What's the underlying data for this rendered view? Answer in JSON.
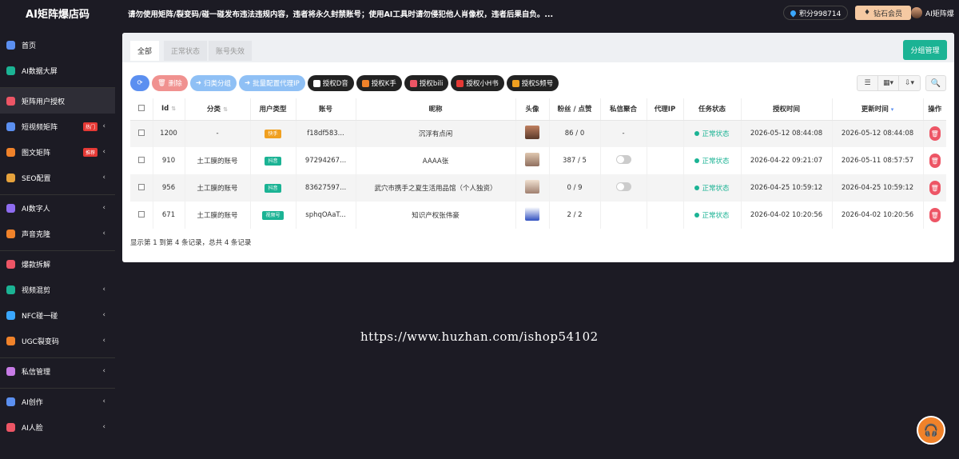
{
  "header": {
    "brand": "AI矩阵爆店码",
    "notice": "请勿使用矩阵/裂变码/碰一碰发布违法违规内容，违者将永久封禁账号；使用AI工具时请勿侵犯他人肖像权，违者后果自负。...",
    "points": "积分998714",
    "vip": "钻石会员",
    "user": "AI矩阵爆"
  },
  "sidebar": {
    "items": [
      {
        "label": "首页",
        "icon": "dashboard-icon",
        "color": "#5b8ff0",
        "arrow": ""
      },
      {
        "label": "AI数据大屏",
        "icon": "screen-icon",
        "color": "#1bb394",
        "arrow": ""
      },
      {
        "label": "矩阵用户授权",
        "icon": "user-auth-icon",
        "color": "#ed5565",
        "arrow": "",
        "active": true
      },
      {
        "label": "短视频矩阵",
        "icon": "video-icon",
        "color": "#5b8ff0",
        "badge": "热门",
        "arrow": "‹"
      },
      {
        "label": "图文矩阵",
        "icon": "image-icon",
        "color": "#f0822a",
        "badge": "推荐",
        "arrow": "‹"
      },
      {
        "label": "SEO配置",
        "icon": "seo-icon",
        "color": "#e6a23c",
        "arrow": "‹"
      },
      {
        "label": "AI数字人",
        "icon": "digital-human-icon",
        "color": "#8e6cf0",
        "arrow": "‹"
      },
      {
        "label": "声音克隆",
        "icon": "voice-icon",
        "color": "#f0822a",
        "arrow": "‹"
      },
      {
        "label": "爆款拆解",
        "icon": "fire-icon",
        "color": "#ed5565",
        "arrow": ""
      },
      {
        "label": "视频混剪",
        "icon": "film-icon",
        "color": "#1bb394",
        "arrow": "‹"
      },
      {
        "label": "NFC碰一碰",
        "icon": "nfc-icon",
        "color": "#3aa7ff",
        "arrow": "‹"
      },
      {
        "label": "UGC裂变码",
        "icon": "qrcode-icon",
        "color": "#f0822a",
        "arrow": "‹"
      },
      {
        "label": "私信管理",
        "icon": "message-icon",
        "color": "#c77be6",
        "arrow": "‹"
      },
      {
        "label": "AI创作",
        "icon": "create-icon",
        "color": "#5b8ff0",
        "arrow": "‹"
      },
      {
        "label": "AI人脸",
        "icon": "face-icon",
        "color": "#ed5565",
        "arrow": "‹"
      }
    ]
  },
  "tabs": [
    "全部",
    "正常状态",
    "账号失效"
  ],
  "group_button": "分组管理",
  "toolbar": {
    "refresh": "⟳",
    "delete": "删除",
    "group": "归类分组",
    "proxy": "批量配置代理IP",
    "auth_d": "授权D音",
    "auth_k": "授权K手",
    "auth_b": "授权bili",
    "auth_x": "授权小H书",
    "auth_s": "授权S频号"
  },
  "columns": [
    "Id",
    "分类",
    "用户类型",
    "账号",
    "昵称",
    "头像",
    "粉丝 / 点赞",
    "私信聚合",
    "代理IP",
    "任务状态",
    "授权时间",
    "更新时间",
    "操作"
  ],
  "rows": [
    {
      "id": "1200",
      "category": "-",
      "type": "快手",
      "type_color": "#f0a020",
      "account": "f18df583...",
      "nickname": "沉浮有点闲",
      "fans": "86 / 0",
      "dm": "-",
      "proxy": "",
      "status": "正常状态",
      "auth_time": "2026-05-12 08:44:08",
      "update_time": "2026-05-12 08:44:08"
    },
    {
      "id": "910",
      "category": "土工膜的账号",
      "type": "抖音",
      "type_color": "#1bb394",
      "account": "97294267...",
      "nickname": "AAAA张",
      "fans": "387 / 5",
      "dm": "toggle",
      "proxy": "",
      "status": "正常状态",
      "auth_time": "2026-04-22 09:21:07",
      "update_time": "2026-05-11 08:57:57"
    },
    {
      "id": "956",
      "category": "土工膜的账号",
      "type": "抖音",
      "type_color": "#1bb394",
      "account": "83627597...",
      "nickname": "武穴市携手之夏生活用品馆（个人独资）",
      "fans": "0 / 9",
      "dm": "toggle",
      "proxy": "",
      "status": "正常状态",
      "auth_time": "2026-04-25 10:59:12",
      "update_time": "2026-04-25 10:59:12"
    },
    {
      "id": "671",
      "category": "土工膜的账号",
      "type": "视频号",
      "type_color": "#1bb394",
      "account": "sphqOAaT...",
      "nickname": "知识产权张伟豪",
      "fans": "2 / 2",
      "dm": "",
      "proxy": "",
      "status": "正常状态",
      "auth_time": "2026-04-02 10:20:56",
      "update_time": "2026-04-02 10:20:56"
    }
  ],
  "summary": "显示第 1 到第 4 条记录，总共 4 条记录",
  "watermark": "https://www.huzhan.com/ishop54102"
}
